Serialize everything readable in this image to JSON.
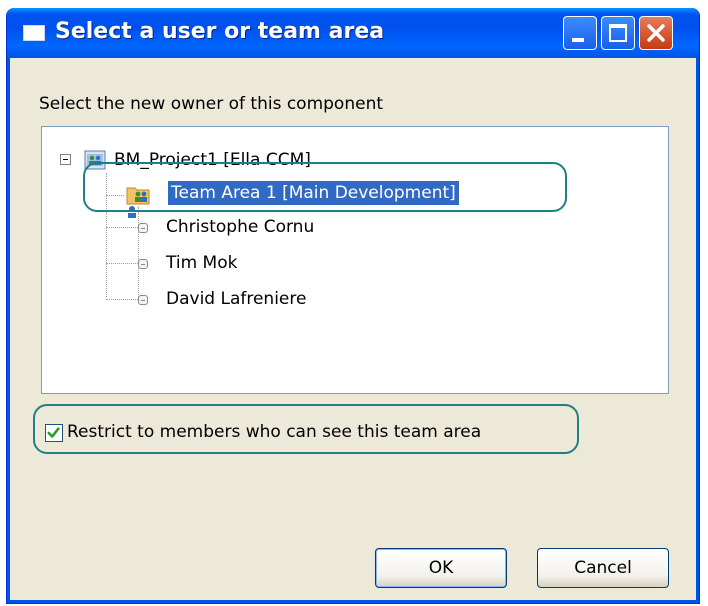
{
  "window": {
    "title": "Select a user or team area"
  },
  "dialog": {
    "prompt": "Select the new owner of this component"
  },
  "tree": {
    "root": {
      "label": "BM_Project1 [Ella CCM]",
      "icon": "project-area-icon"
    },
    "selected_node": {
      "label": "Team Area 1 [Main Development]",
      "icon": "team-area-icon"
    },
    "members": [
      {
        "label": "Christophe Cornu"
      },
      {
        "label": "Tim Mok"
      },
      {
        "label": "David Lafreniere"
      }
    ]
  },
  "restrict": {
    "label": "Restrict to members who can see this team area",
    "checked": true
  },
  "buttons": {
    "ok": "OK",
    "cancel": "Cancel"
  },
  "colors": {
    "title_bar": "#0054e3",
    "selection": "#316ac5",
    "highlight_ring": "#1f7f86",
    "dialog_bg": "#ece9d8"
  }
}
